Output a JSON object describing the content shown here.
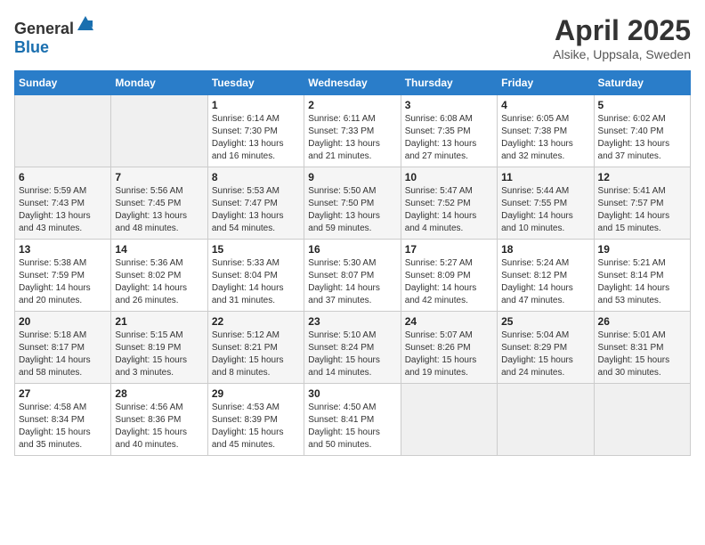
{
  "header": {
    "logo_general": "General",
    "logo_blue": "Blue",
    "title": "April 2025",
    "subtitle": "Alsike, Uppsala, Sweden"
  },
  "weekdays": [
    "Sunday",
    "Monday",
    "Tuesday",
    "Wednesday",
    "Thursday",
    "Friday",
    "Saturday"
  ],
  "weeks": [
    [
      {
        "day": "",
        "sunrise": "",
        "sunset": "",
        "daylight": "",
        "empty": true
      },
      {
        "day": "",
        "sunrise": "",
        "sunset": "",
        "daylight": "",
        "empty": true
      },
      {
        "day": "1",
        "sunrise": "Sunrise: 6:14 AM",
        "sunset": "Sunset: 7:30 PM",
        "daylight": "Daylight: 13 hours and 16 minutes.",
        "empty": false
      },
      {
        "day": "2",
        "sunrise": "Sunrise: 6:11 AM",
        "sunset": "Sunset: 7:33 PM",
        "daylight": "Daylight: 13 hours and 21 minutes.",
        "empty": false
      },
      {
        "day": "3",
        "sunrise": "Sunrise: 6:08 AM",
        "sunset": "Sunset: 7:35 PM",
        "daylight": "Daylight: 13 hours and 27 minutes.",
        "empty": false
      },
      {
        "day": "4",
        "sunrise": "Sunrise: 6:05 AM",
        "sunset": "Sunset: 7:38 PM",
        "daylight": "Daylight: 13 hours and 32 minutes.",
        "empty": false
      },
      {
        "day": "5",
        "sunrise": "Sunrise: 6:02 AM",
        "sunset": "Sunset: 7:40 PM",
        "daylight": "Daylight: 13 hours and 37 minutes.",
        "empty": false
      }
    ],
    [
      {
        "day": "6",
        "sunrise": "Sunrise: 5:59 AM",
        "sunset": "Sunset: 7:43 PM",
        "daylight": "Daylight: 13 hours and 43 minutes.",
        "empty": false
      },
      {
        "day": "7",
        "sunrise": "Sunrise: 5:56 AM",
        "sunset": "Sunset: 7:45 PM",
        "daylight": "Daylight: 13 hours and 48 minutes.",
        "empty": false
      },
      {
        "day": "8",
        "sunrise": "Sunrise: 5:53 AM",
        "sunset": "Sunset: 7:47 PM",
        "daylight": "Daylight: 13 hours and 54 minutes.",
        "empty": false
      },
      {
        "day": "9",
        "sunrise": "Sunrise: 5:50 AM",
        "sunset": "Sunset: 7:50 PM",
        "daylight": "Daylight: 13 hours and 59 minutes.",
        "empty": false
      },
      {
        "day": "10",
        "sunrise": "Sunrise: 5:47 AM",
        "sunset": "Sunset: 7:52 PM",
        "daylight": "Daylight: 14 hours and 4 minutes.",
        "empty": false
      },
      {
        "day": "11",
        "sunrise": "Sunrise: 5:44 AM",
        "sunset": "Sunset: 7:55 PM",
        "daylight": "Daylight: 14 hours and 10 minutes.",
        "empty": false
      },
      {
        "day": "12",
        "sunrise": "Sunrise: 5:41 AM",
        "sunset": "Sunset: 7:57 PM",
        "daylight": "Daylight: 14 hours and 15 minutes.",
        "empty": false
      }
    ],
    [
      {
        "day": "13",
        "sunrise": "Sunrise: 5:38 AM",
        "sunset": "Sunset: 7:59 PM",
        "daylight": "Daylight: 14 hours and 20 minutes.",
        "empty": false
      },
      {
        "day": "14",
        "sunrise": "Sunrise: 5:36 AM",
        "sunset": "Sunset: 8:02 PM",
        "daylight": "Daylight: 14 hours and 26 minutes.",
        "empty": false
      },
      {
        "day": "15",
        "sunrise": "Sunrise: 5:33 AM",
        "sunset": "Sunset: 8:04 PM",
        "daylight": "Daylight: 14 hours and 31 minutes.",
        "empty": false
      },
      {
        "day": "16",
        "sunrise": "Sunrise: 5:30 AM",
        "sunset": "Sunset: 8:07 PM",
        "daylight": "Daylight: 14 hours and 37 minutes.",
        "empty": false
      },
      {
        "day": "17",
        "sunrise": "Sunrise: 5:27 AM",
        "sunset": "Sunset: 8:09 PM",
        "daylight": "Daylight: 14 hours and 42 minutes.",
        "empty": false
      },
      {
        "day": "18",
        "sunrise": "Sunrise: 5:24 AM",
        "sunset": "Sunset: 8:12 PM",
        "daylight": "Daylight: 14 hours and 47 minutes.",
        "empty": false
      },
      {
        "day": "19",
        "sunrise": "Sunrise: 5:21 AM",
        "sunset": "Sunset: 8:14 PM",
        "daylight": "Daylight: 14 hours and 53 minutes.",
        "empty": false
      }
    ],
    [
      {
        "day": "20",
        "sunrise": "Sunrise: 5:18 AM",
        "sunset": "Sunset: 8:17 PM",
        "daylight": "Daylight: 14 hours and 58 minutes.",
        "empty": false
      },
      {
        "day": "21",
        "sunrise": "Sunrise: 5:15 AM",
        "sunset": "Sunset: 8:19 PM",
        "daylight": "Daylight: 15 hours and 3 minutes.",
        "empty": false
      },
      {
        "day": "22",
        "sunrise": "Sunrise: 5:12 AM",
        "sunset": "Sunset: 8:21 PM",
        "daylight": "Daylight: 15 hours and 8 minutes.",
        "empty": false
      },
      {
        "day": "23",
        "sunrise": "Sunrise: 5:10 AM",
        "sunset": "Sunset: 8:24 PM",
        "daylight": "Daylight: 15 hours and 14 minutes.",
        "empty": false
      },
      {
        "day": "24",
        "sunrise": "Sunrise: 5:07 AM",
        "sunset": "Sunset: 8:26 PM",
        "daylight": "Daylight: 15 hours and 19 minutes.",
        "empty": false
      },
      {
        "day": "25",
        "sunrise": "Sunrise: 5:04 AM",
        "sunset": "Sunset: 8:29 PM",
        "daylight": "Daylight: 15 hours and 24 minutes.",
        "empty": false
      },
      {
        "day": "26",
        "sunrise": "Sunrise: 5:01 AM",
        "sunset": "Sunset: 8:31 PM",
        "daylight": "Daylight: 15 hours and 30 minutes.",
        "empty": false
      }
    ],
    [
      {
        "day": "27",
        "sunrise": "Sunrise: 4:58 AM",
        "sunset": "Sunset: 8:34 PM",
        "daylight": "Daylight: 15 hours and 35 minutes.",
        "empty": false
      },
      {
        "day": "28",
        "sunrise": "Sunrise: 4:56 AM",
        "sunset": "Sunset: 8:36 PM",
        "daylight": "Daylight: 15 hours and 40 minutes.",
        "empty": false
      },
      {
        "day": "29",
        "sunrise": "Sunrise: 4:53 AM",
        "sunset": "Sunset: 8:39 PM",
        "daylight": "Daylight: 15 hours and 45 minutes.",
        "empty": false
      },
      {
        "day": "30",
        "sunrise": "Sunrise: 4:50 AM",
        "sunset": "Sunset: 8:41 PM",
        "daylight": "Daylight: 15 hours and 50 minutes.",
        "empty": false
      },
      {
        "day": "",
        "sunrise": "",
        "sunset": "",
        "daylight": "",
        "empty": true
      },
      {
        "day": "",
        "sunrise": "",
        "sunset": "",
        "daylight": "",
        "empty": true
      },
      {
        "day": "",
        "sunrise": "",
        "sunset": "",
        "daylight": "",
        "empty": true
      }
    ]
  ]
}
